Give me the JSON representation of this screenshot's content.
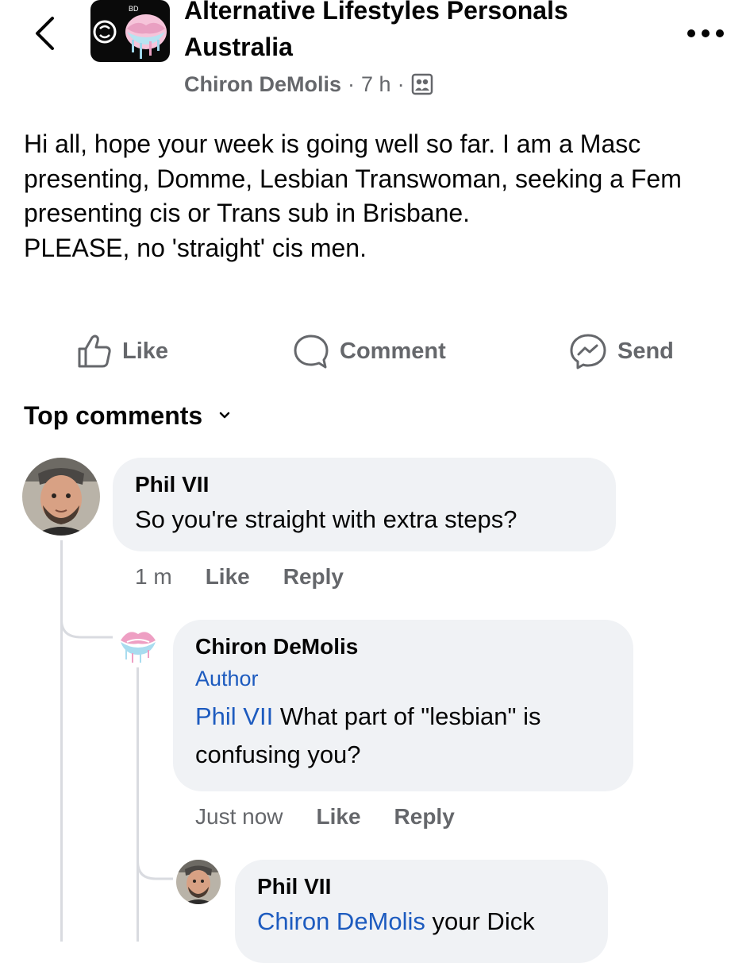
{
  "header": {
    "group_name": "Alternative Lifestyles Personals Australia",
    "author": "Chiron DeMolis",
    "time": "7 h",
    "separator": "·",
    "privacy_icon": "members-group-icon",
    "back_icon": "chevron-left-icon",
    "more_icon": "more-dots-icon"
  },
  "post": {
    "lines": [
      "Hi all, hope your week is going well so far. I am a Masc presenting, Domme, Lesbian Transwoman, seeking a Fem presenting cis or Trans sub in Brisbane.",
      "PLEASE, no 'straight' cis men."
    ]
  },
  "actions": {
    "like": "Like",
    "comment": "Comment",
    "send": "Send"
  },
  "top_comments": {
    "label": "Top comments"
  },
  "comments": [
    {
      "name": "Phil VII",
      "text": "So you're straight with extra steps?",
      "time": "1 m",
      "like": "Like",
      "reply": "Reply"
    },
    {
      "name": "Chiron DeMolis",
      "badge": "Author",
      "mention": "Phil VII",
      "text": " What part of \"lesbian\" is confusing you?",
      "time": "Just now",
      "like": "Like",
      "reply": "Reply"
    },
    {
      "name": "Phil VII",
      "mention": "Chiron DeMolis",
      "text": " your Dick"
    }
  ],
  "colors": {
    "text": "#050505",
    "secondary": "#65676b",
    "bubble": "#f0f2f5",
    "link": "#1d5bbf",
    "thread": "#d9dbe0"
  }
}
